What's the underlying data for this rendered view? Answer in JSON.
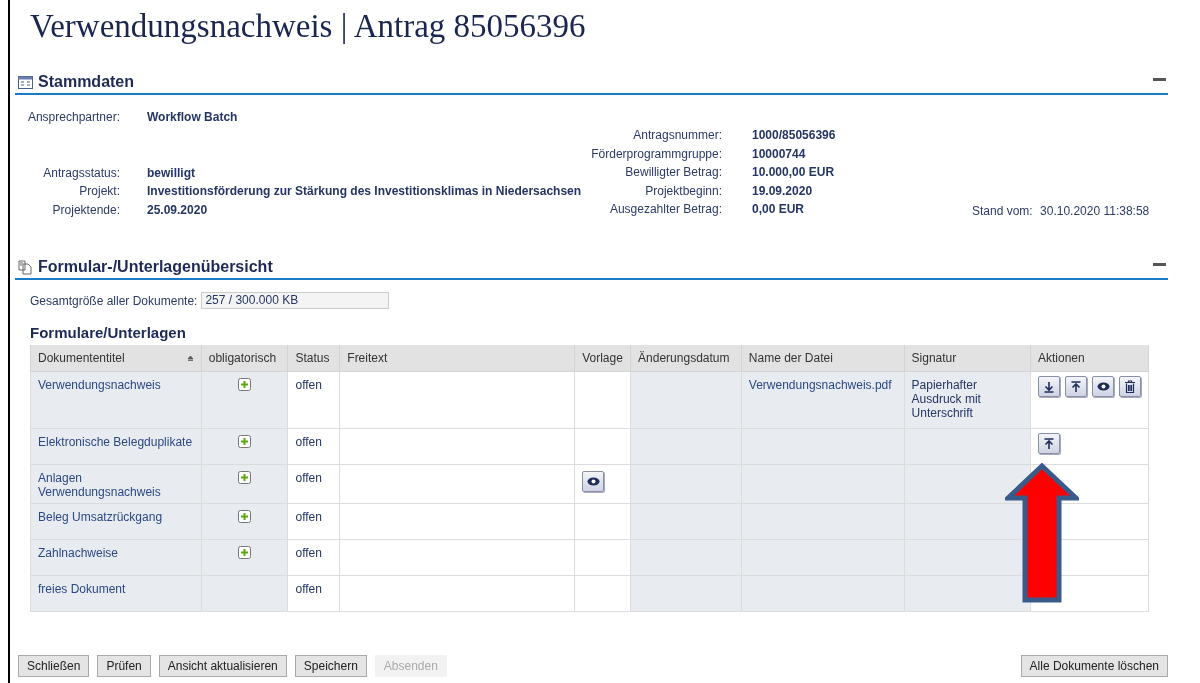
{
  "title": "Verwendungsnachweis | Antrag 85056396",
  "stammdaten": {
    "heading": "Stammdaten",
    "expanded": true,
    "left": [
      {
        "label": "Ansprechpartner:",
        "value": "Workflow Batch"
      },
      {
        "label": "Antragsstatus:",
        "value": "bewilligt"
      },
      {
        "label": "Projekt:",
        "value": "Investitionsförderung zur Stärkung des Investitionsklimas in Niedersachsen"
      },
      {
        "label": "Projektende:",
        "value": "25.09.2020"
      }
    ],
    "right": [
      {
        "label": "Antragsnummer:",
        "value": "1000/85056396"
      },
      {
        "label": "Förderprogrammgruppe:",
        "value": "10000744"
      },
      {
        "label": "Bewilligter Betrag:",
        "value": "10.000,00 EUR"
      },
      {
        "label": "Projektbeginn:",
        "value": "19.09.2020"
      },
      {
        "label": "Ausgezahlter Betrag:",
        "value": "0,00 EUR"
      }
    ],
    "stand_label": "Stand vom:",
    "stand_value": "30.10.2020 11:38:58"
  },
  "uebersicht": {
    "heading": "Formular-/Unterlagenübersicht",
    "expanded": true,
    "size_label": "Gesamtgröße aller Dokumente:",
    "size_value": "257 / 300.000 KB",
    "table_title": "Formulare/Unterlagen",
    "columns": [
      {
        "label": "Dokumententitel",
        "sorted": true
      },
      {
        "label": "obligatorisch",
        "sorted": false
      },
      {
        "label": "Status",
        "sorted": false
      },
      {
        "label": "Freitext",
        "sorted": false
      },
      {
        "label": "Vorlage",
        "sorted": false
      },
      {
        "label": "Änderungsdatum",
        "sorted": false
      },
      {
        "label": "Name der Datei",
        "sorted": false
      },
      {
        "label": "Signatur",
        "sorted": false
      },
      {
        "label": "Aktionen",
        "sorted": false
      }
    ],
    "rows": [
      {
        "title": "Verwendungsnachweis",
        "mandatory": true,
        "status": "offen",
        "template": false,
        "file": "Verwendungsnachweis.pdf",
        "signature": "Papierhafter Ausdruck mit Unterschrift",
        "actions": [
          {
            "kind": "download"
          },
          {
            "kind": "upload"
          },
          {
            "kind": "view"
          },
          {
            "kind": "delete"
          }
        ]
      },
      {
        "title": "Elektronische Belegduplikate",
        "mandatory": true,
        "status": "offen",
        "template": false,
        "actions": [
          {
            "kind": "upload"
          }
        ]
      },
      {
        "title": "Anlagen Verwendungsnachweis",
        "mandatory": true,
        "status": "offen",
        "template": true,
        "actions": []
      },
      {
        "title": "Beleg Umsatzrückgang",
        "mandatory": true,
        "status": "offen",
        "template": false,
        "actions": []
      },
      {
        "title": "Zahlnachweise",
        "mandatory": true,
        "status": "offen",
        "template": false,
        "actions": []
      },
      {
        "title": "freies Dokument",
        "mandatory": false,
        "status": "offen",
        "template": false,
        "actions": []
      }
    ]
  },
  "annotation_arrow": true,
  "buttons": [
    {
      "label": "Schließen",
      "disabled": false
    },
    {
      "label": "Prüfen",
      "disabled": false
    },
    {
      "label": "Ansicht aktualisieren",
      "disabled": false
    },
    {
      "label": "Speichern",
      "disabled": false
    },
    {
      "label": "Absenden",
      "disabled": true
    }
  ],
  "right_button": {
    "label": "Alle Dokumente löschen",
    "disabled": false
  }
}
